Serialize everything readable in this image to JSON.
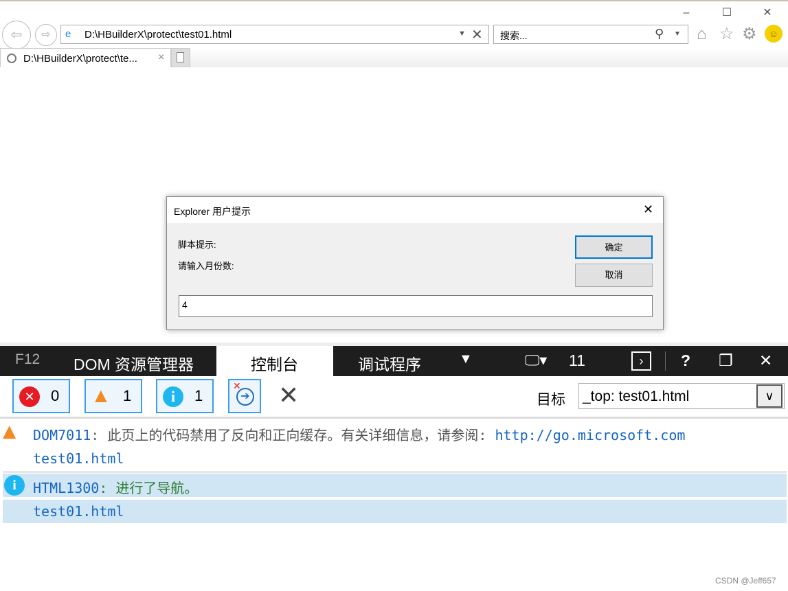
{
  "browser": {
    "address": "D:\\HBuilderX\\protect\\test01.html",
    "search_placeholder": "搜索...",
    "tab_title": "D:\\HBuilderX\\protect\\te...",
    "tab_close": "×"
  },
  "dialog": {
    "title": "Explorer 用户提示",
    "label1": "脚本提示:",
    "label2": "请输入月份数:",
    "ok": "确定",
    "cancel": "取消",
    "input_value": "4"
  },
  "devtools": {
    "f12": "F12",
    "tabs": [
      "DOM 资源管理器",
      "控制台",
      "调试程序"
    ],
    "active_tab": "控制台",
    "version": "11",
    "error_count": "0",
    "warning_count": "1",
    "info_count": "1",
    "target_label": "目标",
    "target_value": "_top: test01.html"
  },
  "console": [
    {
      "type": "warning",
      "code": "DOM7011",
      "sep": ":",
      "message": " 此页上的代码禁用了反向和正向缓存。有关详细信息，请参阅: ",
      "link": "http://go.microsoft.com",
      "source": "test01.html"
    },
    {
      "type": "info",
      "code": "HTML1300",
      "sep": ":",
      "message": " 进行了导航。",
      "source": "test01.html"
    }
  ],
  "watermark": "CSDN @Jeff657"
}
